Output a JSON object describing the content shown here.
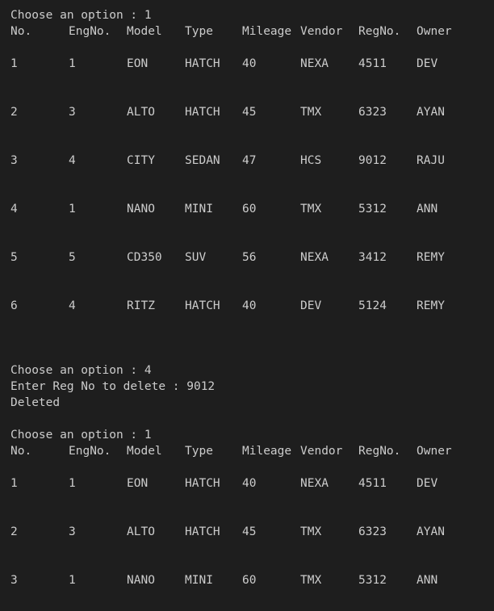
{
  "session1": {
    "prompt": "Choose an option : 1",
    "headers": [
      "No.",
      "EngNo.",
      "Model",
      "Type",
      "Mileage",
      "Vendor",
      "RegNo.",
      "Owner"
    ],
    "rows": [
      [
        "1",
        "1",
        "EON",
        "HATCH",
        "40",
        "NEXA",
        "4511",
        "DEV"
      ],
      [
        "2",
        "3",
        "ALTO",
        "HATCH",
        "45",
        "TMX",
        "6323",
        "AYAN"
      ],
      [
        "3",
        "4",
        "CITY",
        "SEDAN",
        "47",
        "HCS",
        "9012",
        "RAJU"
      ],
      [
        "4",
        "1",
        "NANO",
        "MINI",
        "60",
        "TMX",
        "5312",
        "ANN"
      ],
      [
        "5",
        "5",
        "CD350",
        "SUV",
        "56",
        "NEXA",
        "3412",
        "REMY"
      ],
      [
        "6",
        "4",
        "RITZ",
        "HATCH",
        "40",
        "DEV",
        "5124",
        "REMY"
      ]
    ]
  },
  "session2": {
    "prompt": "Choose an option : 4",
    "input_line": "Enter Reg No to delete : 9012",
    "result": "Deleted"
  },
  "session3": {
    "prompt": "Choose an option : 1",
    "headers": [
      "No.",
      "EngNo.",
      "Model",
      "Type",
      "Mileage",
      "Vendor",
      "RegNo.",
      "Owner"
    ],
    "rows": [
      [
        "1",
        "1",
        "EON",
        "HATCH",
        "40",
        "NEXA",
        "4511",
        "DEV"
      ],
      [
        "2",
        "3",
        "ALTO",
        "HATCH",
        "45",
        "TMX",
        "6323",
        "AYAN"
      ],
      [
        "3",
        "1",
        "NANO",
        "MINI",
        "60",
        "TMX",
        "5312",
        "ANN"
      ]
    ]
  },
  "colors": {
    "background": "#1e1e1e",
    "text": "#cccccc"
  }
}
